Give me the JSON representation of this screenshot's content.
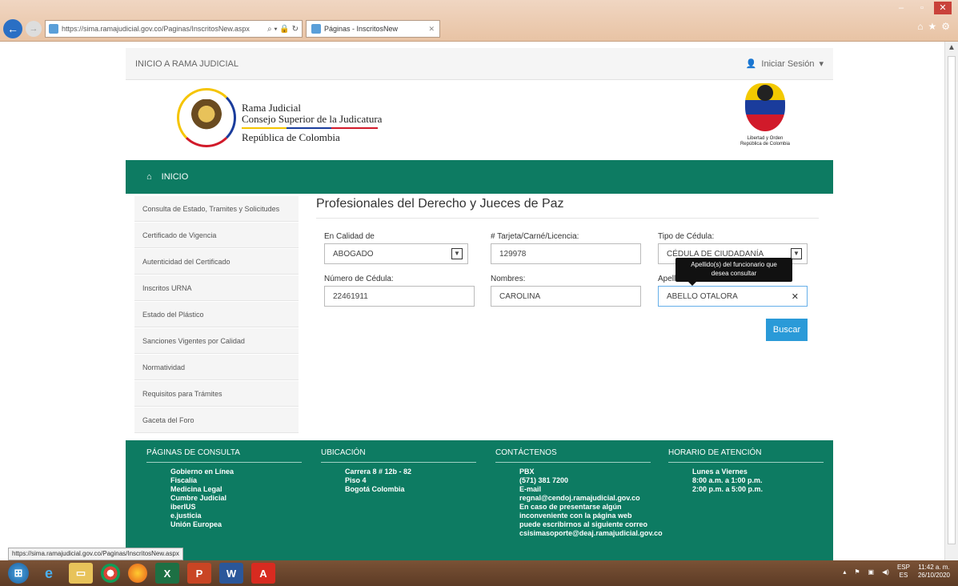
{
  "browser": {
    "url": "https://sima.ramajudicial.gov.co/Paginas/InscritosNew.aspx",
    "tab_label": "Páginas - InscritosNew",
    "status_url": "https://sima.ramajudicial.gov.co/Paginas/InscritosNew.aspx"
  },
  "topbar": {
    "home_link": "INICIO A RAMA JUDICIAL",
    "login": "Iniciar Sesión"
  },
  "brand": {
    "line1": "Rama Judicial",
    "line2": "Consejo Superior de la Judicatura",
    "line3": "República de Colombia",
    "crest_line1": "Libertad y Orden",
    "crest_line2": "República de Colombia"
  },
  "navbar": {
    "inicio": "INICIO"
  },
  "sidebar": {
    "items": [
      "Consulta de Estado, Tramites y Solicitudes",
      "Certificado de Vigencia",
      "Autenticidad del Certificado",
      "Inscritos URNA",
      "Estado del Plástico",
      "Sanciones Vigentes por Calidad",
      "Normatividad",
      "Requisitos para Trámites",
      "Gaceta del Foro"
    ]
  },
  "form": {
    "title": "Profesionales del Derecho y Jueces de Paz",
    "calidad": {
      "label": "En Calidad de",
      "value": "ABOGADO"
    },
    "tarjeta": {
      "label": "# Tarjeta/Carné/Licencia:",
      "value": "129978"
    },
    "tipo_cedula": {
      "label": "Tipo de Cédula:",
      "value": "CÉDULA DE CIUDADANÍA"
    },
    "numero_cedula": {
      "label": "Número de Cédula:",
      "value": "22461911"
    },
    "nombres": {
      "label": "Nombres:",
      "value": "CAROLINA"
    },
    "apellidos": {
      "label": "Apellidos:",
      "value": "ABELLO OTALORA"
    },
    "tooltip_line1": "Apellido(s) del funcionario que",
    "tooltip_line2": "desea consultar",
    "buscar": "Buscar"
  },
  "footer": {
    "col1": {
      "title": "PÁGINAS DE CONSULTA",
      "lines": [
        "Gobierno en Línea",
        "Fiscalía",
        "Medicina Legal",
        "Cumbre Judicial",
        "iberIUS",
        "e.justicia",
        "Unión Europea"
      ]
    },
    "col2": {
      "title": "UBICACIÓN",
      "lines": [
        "Carrera 8 # 12b - 82",
        "Piso 4",
        "Bogotá Colombia"
      ]
    },
    "col3": {
      "title": "CONTÁCTENOS",
      "lines": [
        "PBX",
        "(571) 381 7200",
        "E-mail",
        "regnal@cendoj.ramajudicial.gov.co",
        "En caso de presentarse algún",
        "inconveniente con la página web",
        "puede escribirnos al siguiente correo",
        "csisimasoporte@deaj.ramajudicial.gov.co"
      ]
    },
    "col4": {
      "title": "HORARIO DE ATENCIÓN",
      "lines": [
        "Lunes a Viernes",
        "8:00 a.m. a 1:00 p.m.",
        "2:00 p.m. a 5:00 p.m."
      ]
    }
  },
  "taskbar": {
    "lang": "ESP",
    "lang_sub": "ES",
    "time": "11:42 a. m.",
    "date": "26/10/2020"
  }
}
